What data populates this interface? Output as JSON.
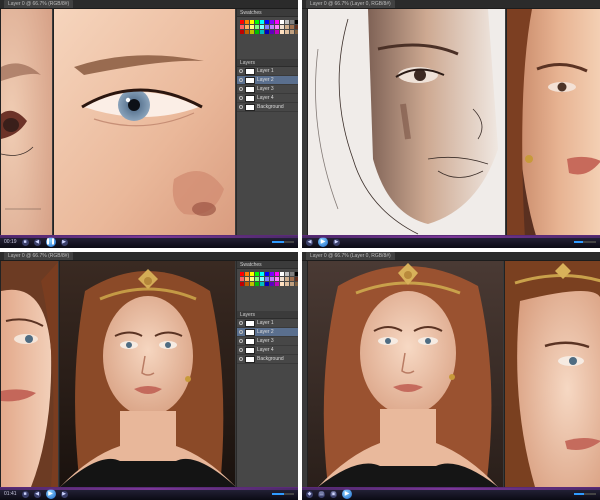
{
  "panels": [
    {
      "id": "q1",
      "doc_tab": "Layer 0 @ 66.7% (RGB/8#)",
      "layers_header": "Layers",
      "layers": [
        "Layer 1",
        "Layer 2",
        "Layer 3",
        "Layer 4",
        "Background"
      ],
      "player": {
        "time": "00:19",
        "play_icon": "pause-icon"
      }
    },
    {
      "id": "q2",
      "doc_tab": "Layer 0 @ 66.7% (Layer 0, RGB/8#)",
      "player": {
        "time": "",
        "play_icon": "play-icon"
      }
    },
    {
      "id": "q3",
      "doc_tab": "Layer 0 @ 66.7% (RGB/8#)",
      "layers_header": "Layers",
      "layers": [
        "Layer 1",
        "Layer 2",
        "Layer 3",
        "Layer 4",
        "Background"
      ],
      "player": {
        "time": "01:41",
        "play_icon": "play-icon"
      }
    },
    {
      "id": "q4",
      "doc_tab": "Layer 0 @ 66.7% (Layer 0, RGB/8#)",
      "player": {
        "time": "",
        "play_icon": "play-icon"
      }
    }
  ],
  "colors": {
    "ps_bg": "#3a3a3a",
    "player_accent": "#2f9bff",
    "selected_layer": "#5a6f8e",
    "skin_light": "#f2c7ad",
    "skin_mid": "#d99c7f",
    "hair": "#8a4a2a"
  },
  "swatch_colors": [
    "#ff0000",
    "#ff8000",
    "#ffff00",
    "#00ff00",
    "#00ffff",
    "#0000ff",
    "#8000ff",
    "#ff00ff",
    "#ffffff",
    "#c0c0c0",
    "#808080",
    "#000000",
    "#ff6060",
    "#ffb060",
    "#ffff80",
    "#80ff80",
    "#80ffff",
    "#8080ff",
    "#c080ff",
    "#ff80ff",
    "#f0e0d0",
    "#d0b090",
    "#a07050",
    "#603020",
    "#c00000",
    "#c06000",
    "#c0c000",
    "#00c000",
    "#00c0c0",
    "#0000c0",
    "#6000c0",
    "#c000c0",
    "#ffe0c0",
    "#e0c0a0",
    "#c0a080",
    "#806040"
  ]
}
